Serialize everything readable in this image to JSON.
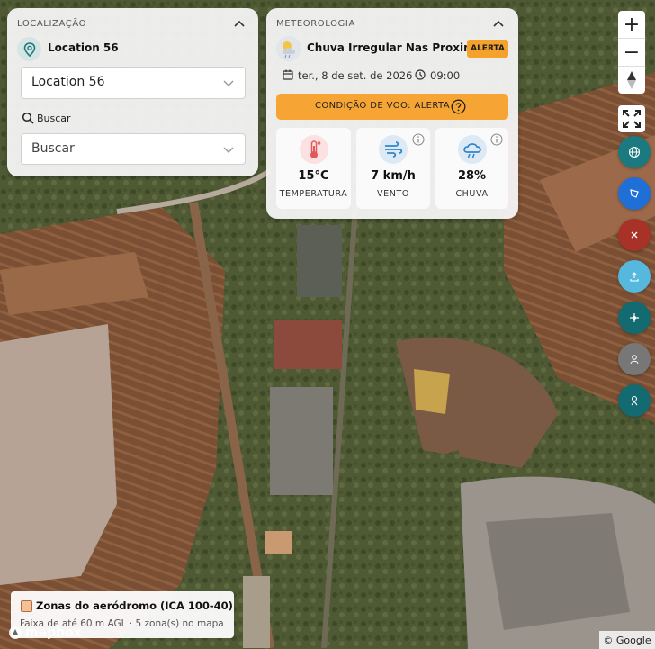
{
  "location_panel": {
    "header": "LOCALIZAÇÃO",
    "current_location": "Location 56",
    "location_select_value": "Location 56",
    "search_label": "Buscar",
    "search_select_value": "Buscar"
  },
  "weather_panel": {
    "header": "METEOROLOGIA",
    "condition_title": "Chuva Irregular Nas Proximid...",
    "badge": "ALERTA",
    "date": "ter., 8 de set. de 2026",
    "time": "09:00",
    "flight_condition": "CONDIÇÃO DE VOO: ALERTA",
    "stats": [
      {
        "value": "15°C",
        "label": "TEMPERATURA",
        "icon": "thermometer-icon",
        "color": "#e05a5a"
      },
      {
        "value": "7 km/h",
        "label": "VENTO",
        "icon": "wind-icon",
        "color": "#2f86c9"
      },
      {
        "value": "28%",
        "label": "CHUVA",
        "icon": "rain-cloud-icon",
        "color": "#2f86c9"
      }
    ]
  },
  "map_controls": {
    "zoom_in": "+",
    "zoom_out": "−",
    "tools": [
      {
        "name": "globe-icon",
        "color": "#1b7a80"
      },
      {
        "name": "draw-polygon-icon",
        "color": "#1f6fd6"
      },
      {
        "name": "close-icon",
        "color": "#a83228"
      },
      {
        "name": "upload-icon",
        "color": "#56b8dc"
      },
      {
        "name": "drone-icon",
        "color": "#136a71"
      },
      {
        "name": "user-location-icon",
        "color": "#777777"
      },
      {
        "name": "pin-person-icon",
        "color": "#136a71"
      }
    ]
  },
  "legend": {
    "title": "Zonas do aeródromo (ICA 100-40)",
    "subtitle": "Faixa de até 60 m AGL · 5 zona(s) no mapa",
    "swatch_color": "#f2c39a"
  },
  "map": {
    "logo": "mapbox",
    "attribution": "© Google"
  }
}
